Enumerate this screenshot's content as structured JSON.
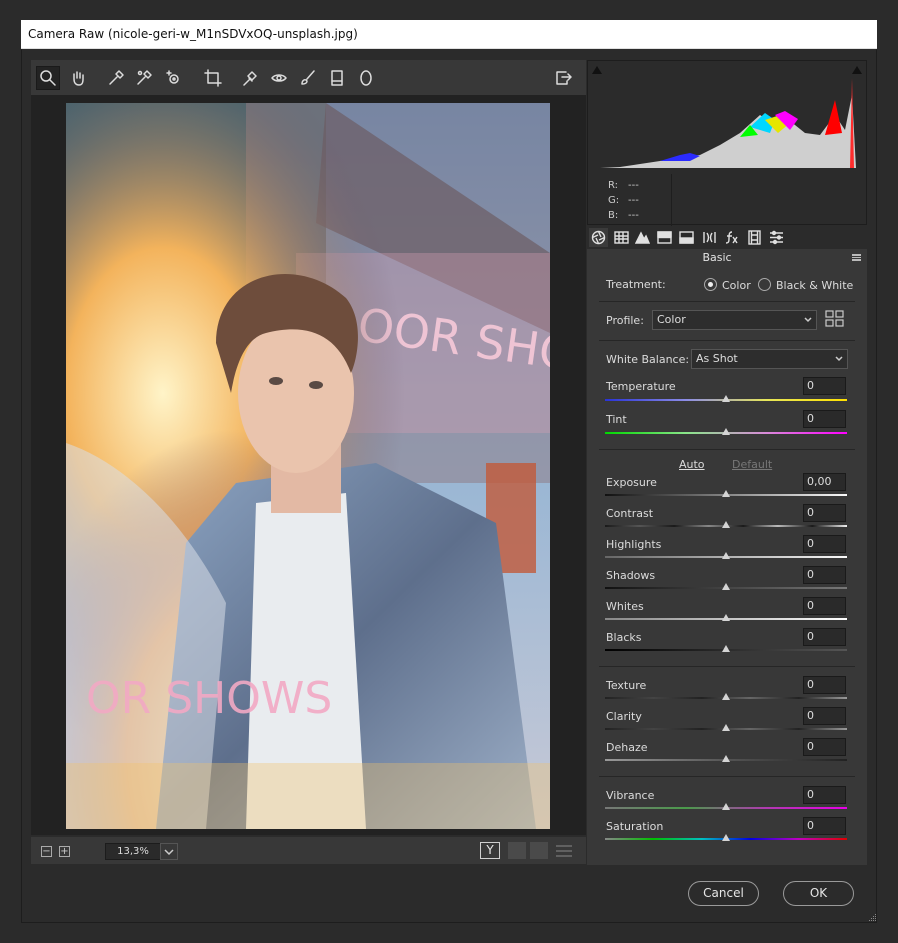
{
  "window": {
    "title": "Camera Raw (nicole-geri-w_M1nSDVxOQ-unsplash.jpg)"
  },
  "toolbar": {
    "tools": [
      "zoom-tool",
      "hand-tool",
      "white-balance-tool",
      "color-sampler-tool",
      "targeted-adjustment-tool",
      "crop-tool",
      "spot-removal-tool",
      "red-eye-tool",
      "adjustment-brush-tool",
      "graduated-filter-tool",
      "radial-filter-tool"
    ],
    "active_tool": "zoom-tool"
  },
  "status": {
    "zoom": "13,3%",
    "minus": "−",
    "plus": "+"
  },
  "histogram": {
    "r_label": "R:",
    "g_label": "G:",
    "b_label": "B:",
    "r_value": "---",
    "g_value": "---",
    "b_value": "---"
  },
  "panel": {
    "title": "Basic",
    "treatment_label": "Treatment:",
    "treatment_color": "Color",
    "treatment_bw": "Black & White",
    "treatment_selected": "Color",
    "profile_label": "Profile:",
    "profile_value": "Color",
    "wb_label": "White Balance:",
    "wb_value": "As Shot",
    "auto_label": "Auto",
    "default_label": "Default",
    "sliders": {
      "temperature": {
        "label": "Temperature",
        "value": "0"
      },
      "tint": {
        "label": "Tint",
        "value": "0"
      },
      "exposure": {
        "label": "Exposure",
        "value": "0,00"
      },
      "contrast": {
        "label": "Contrast",
        "value": "0"
      },
      "highlights": {
        "label": "Highlights",
        "value": "0"
      },
      "shadows": {
        "label": "Shadows",
        "value": "0"
      },
      "whites": {
        "label": "Whites",
        "value": "0"
      },
      "blacks": {
        "label": "Blacks",
        "value": "0"
      },
      "texture": {
        "label": "Texture",
        "value": "0"
      },
      "clarity": {
        "label": "Clarity",
        "value": "0"
      },
      "dehaze": {
        "label": "Dehaze",
        "value": "0"
      },
      "vibrance": {
        "label": "Vibrance",
        "value": "0"
      },
      "saturation": {
        "label": "Saturation",
        "value": "0"
      }
    }
  },
  "buttons": {
    "cancel": "Cancel",
    "ok": "OK"
  }
}
